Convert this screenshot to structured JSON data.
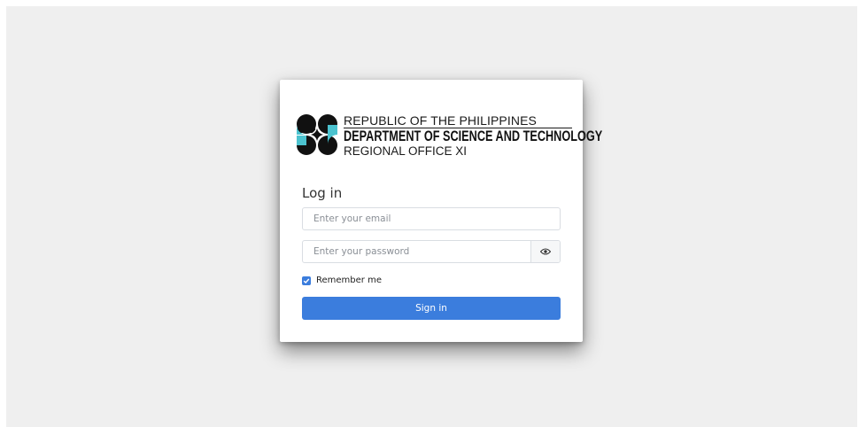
{
  "logo": {
    "line1": "REPUBLIC OF THE PHILIPPINES",
    "line2": "DEPARTMENT OF SCIENCE AND TECHNOLOGY",
    "line3": "REGIONAL OFFICE XI",
    "colors": {
      "dark": "#111111",
      "teal": "#4cc3cf"
    }
  },
  "form": {
    "title": "Log in",
    "email_placeholder": "Enter your email",
    "email_value": "",
    "password_placeholder": "Enter your password",
    "password_value": "",
    "show_password_icon": "eye-icon",
    "remember_label": "Remember me",
    "remember_checked": true,
    "signin_label": "Sign in"
  },
  "colors": {
    "accent": "#3b7ddd",
    "background": "#efefef",
    "card": "#ffffff"
  }
}
